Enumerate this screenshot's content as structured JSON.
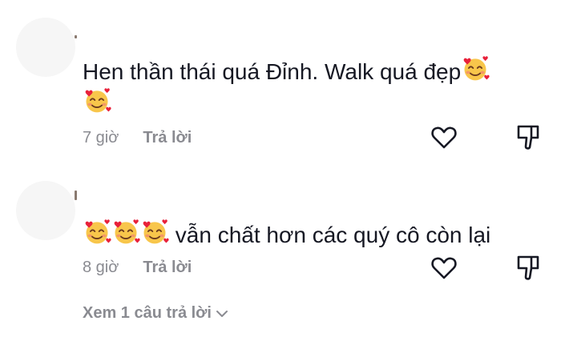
{
  "comments": [
    {
      "text_line1": "Hen thần thái quá Đỉnh. Walk quá đẹp",
      "time": "7 giờ",
      "reply_label": "Trả lời"
    },
    {
      "text": "vẫn chất hơn các quý cô còn lại",
      "time": "8 giờ",
      "reply_label": "Trả lời"
    }
  ],
  "view_replies_label": "Xem 1 câu trả lời",
  "icons": [
    "heart-outline-icon",
    "dislike-icon",
    "smiling-face-with-hearts-emoji",
    "chevron-down-icon"
  ],
  "colors": {
    "text": "#161823",
    "muted": "#8a8b91",
    "avatar": "#f6f6f6"
  }
}
